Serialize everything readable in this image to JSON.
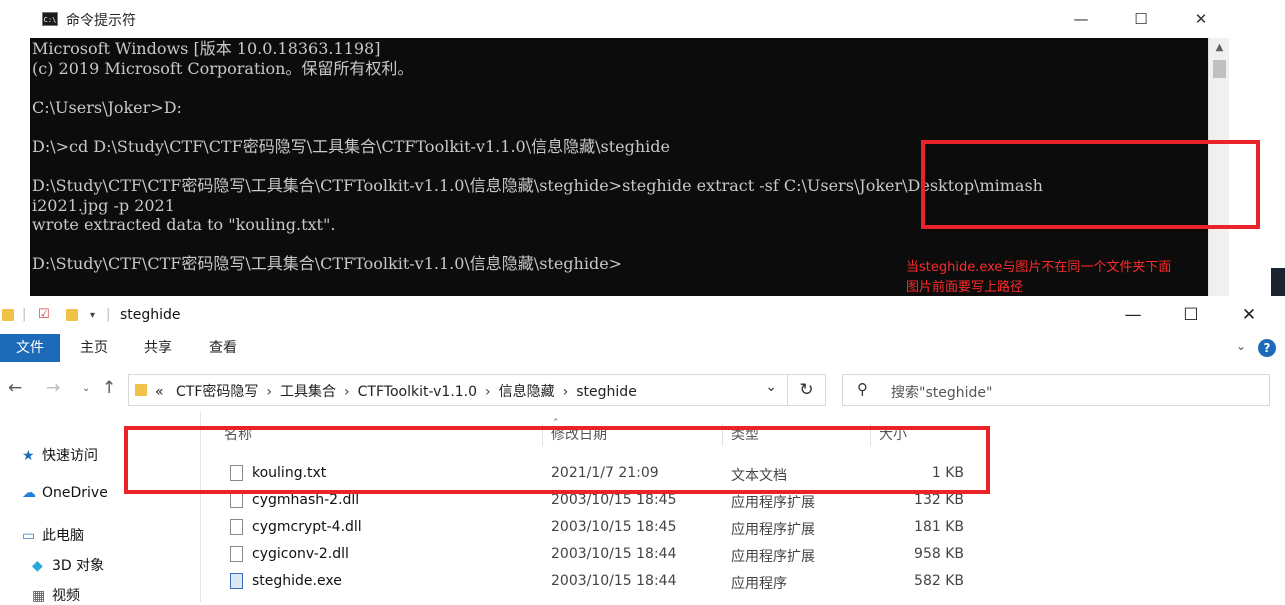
{
  "cmd": {
    "title": "命令提示符",
    "icon": "cmd-icon",
    "lines": [
      "Microsoft Windows [版本 10.0.18363.1198]",
      "(c) 2019 Microsoft Corporation。保留所有权利。",
      "",
      "C:\\Users\\Joker>D:",
      "",
      "D:\\>cd D:\\Study\\CTF\\CTF密码隐写\\工具集合\\CTFToolkit-v1.1.0\\信息隐藏\\steghide",
      "",
      "D:\\Study\\CTF\\CTF密码隐写\\工具集合\\CTFToolkit-v1.1.0\\信息隐藏\\steghide>steghide extract -sf C:\\Users\\Joker\\Desktop\\mimash",
      "i2021.jpg -p 2021",
      "wrote extracted data to \"kouling.txt\".",
      "",
      "D:\\Study\\CTF\\CTF密码隐写\\工具集合\\CTFToolkit-v1.1.0\\信息隐藏\\steghide>"
    ],
    "buttons": {
      "minimize": "—",
      "maximize": "☐",
      "close": "✕"
    }
  },
  "annotation": {
    "line1": "当steghide.exe与图片不在同一个文件夹下面",
    "line2": "图片前面要写上路径"
  },
  "explorer": {
    "title": "steghide",
    "buttons": {
      "minimize": "—",
      "maximize": "☐",
      "close": "✕"
    },
    "ribbon_tabs": [
      "文件",
      "主页",
      "共享",
      "查看"
    ],
    "breadcrumb": [
      "«",
      "CTF密码隐写",
      "工具集合",
      "CTFToolkit-v1.1.0",
      "信息隐藏",
      "steghide"
    ],
    "search_placeholder": "搜索\"steghide\"",
    "sidebar": [
      {
        "label": "快速访问",
        "icon": "star-icon"
      },
      {
        "label": "OneDrive",
        "icon": "cloud-icon"
      },
      {
        "label": "此电脑",
        "icon": "computer-icon"
      },
      {
        "label": "3D 对象",
        "icon": "cube-icon"
      },
      {
        "label": "视频",
        "icon": "video-icon"
      }
    ],
    "columns": [
      "名称",
      "修改日期",
      "类型",
      "大小"
    ],
    "files": [
      {
        "name": "kouling.txt",
        "date": "2021/1/7 21:09",
        "type": "文本文档",
        "size": "1 KB",
        "icon": "text-file-icon"
      },
      {
        "name": "cygmhash-2.dll",
        "date": "2003/10/15 18:45",
        "type": "应用程序扩展",
        "size": "132 KB",
        "icon": "dll-file-icon"
      },
      {
        "name": "cygmcrypt-4.dll",
        "date": "2003/10/15 18:45",
        "type": "应用程序扩展",
        "size": "181 KB",
        "icon": "dll-file-icon"
      },
      {
        "name": "cygiconv-2.dll",
        "date": "2003/10/15 18:44",
        "type": "应用程序扩展",
        "size": "958 KB",
        "icon": "dll-file-icon"
      },
      {
        "name": "steghide.exe",
        "date": "2003/10/15 18:44",
        "type": "应用程序",
        "size": "582 KB",
        "icon": "exe-file-icon"
      }
    ]
  },
  "colors": {
    "highlight_red": "#e8232a",
    "annotation_red": "#ff2a2a",
    "console_bg": "#0c0c0c",
    "console_fg": "#c8c8c8",
    "ribbon_blue": "#1d6bb8"
  }
}
